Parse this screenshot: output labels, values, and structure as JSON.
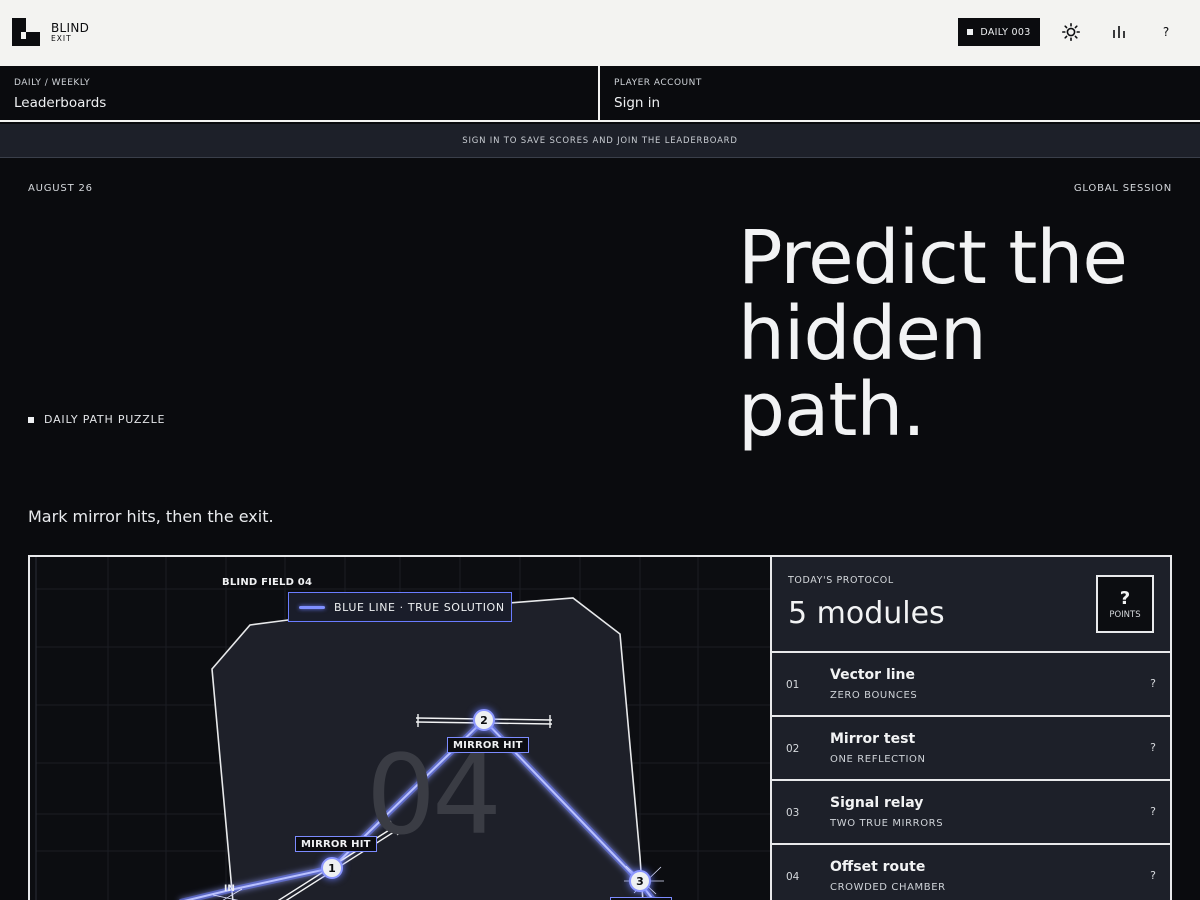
{
  "header": {
    "brand_line1": "BLIND",
    "brand_line2": "EXIT",
    "daily_badge": "DAILY 003",
    "icons": [
      "sun-icon",
      "stats-icon",
      "help-icon"
    ],
    "help_label": "?"
  },
  "panels": {
    "leaderboards": {
      "caption": "DAILY / WEEKLY",
      "label": "Leaderboards"
    },
    "account": {
      "caption": "PLAYER ACCOUNT",
      "label": "Sign in"
    }
  },
  "banner": "SIGN IN TO SAVE SCORES AND JOIN THE LEADERBOARD",
  "session": {
    "date": "AUGUST 26",
    "mode": "GLOBAL SESSION",
    "headline": "Predict the hidden path.",
    "tag": "DAILY PATH PUZZLE",
    "instruction": "Mark mirror hits, then the exit."
  },
  "game": {
    "field_label": "BLIND FIELD 04",
    "legend": "BLUE LINE · TRUE SOLUTION",
    "field_number": "04",
    "entry_label": "IN",
    "nodes": [
      {
        "number": "1",
        "tag": "MIRROR HIT"
      },
      {
        "number": "2",
        "tag": "MIRROR HIT"
      },
      {
        "number": "3",
        "tag": ""
      }
    ],
    "colors": {
      "path": "#6a7cff",
      "chamber": "#1e2029",
      "background": "#0c0d11"
    }
  },
  "protocol": {
    "caption": "TODAY'S PROTOCOL",
    "value": "5 modules",
    "points_mark": "?",
    "points_label": "POINTS"
  },
  "modules": [
    {
      "num": "01",
      "title": "Vector line",
      "subtitle": "ZERO BOUNCES",
      "score": "?"
    },
    {
      "num": "02",
      "title": "Mirror test",
      "subtitle": "ONE REFLECTION",
      "score": "?"
    },
    {
      "num": "03",
      "title": "Signal relay",
      "subtitle": "TWO TRUE MIRRORS",
      "score": "?"
    },
    {
      "num": "04",
      "title": "Offset route",
      "subtitle": "CROWDED CHAMBER",
      "score": "?"
    }
  ]
}
